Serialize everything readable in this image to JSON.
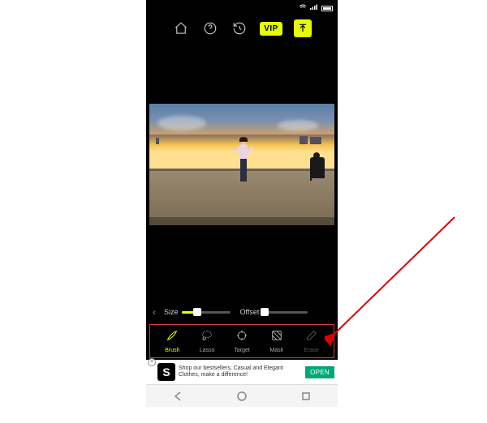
{
  "topbar": {
    "home_icon": "home-icon",
    "help_icon": "help-icon",
    "history_icon": "history-icon",
    "vip_label": "VIP",
    "export_icon": "upload-icon"
  },
  "sliders": {
    "size_label": "Size",
    "size_value_pct": 32,
    "offset_label": "Offset",
    "offset_value_pct": 4
  },
  "tools": {
    "items": [
      {
        "key": "brush",
        "label": "Brush",
        "active": true,
        "disabled": false
      },
      {
        "key": "lasso",
        "label": "Lasso",
        "active": false,
        "disabled": false
      },
      {
        "key": "target",
        "label": "Target",
        "active": false,
        "disabled": false
      },
      {
        "key": "mask",
        "label": "Mask",
        "active": false,
        "disabled": false
      },
      {
        "key": "erase",
        "label": "Erase",
        "active": false,
        "disabled": true
      }
    ]
  },
  "ad": {
    "logo_letter": "S",
    "text": "Shop our bestsellers, Casual and Elegant Clothes, make a difference!",
    "cta": "OPEN"
  },
  "colors": {
    "accent": "#e6ff00",
    "ad_cta": "#00a878"
  }
}
